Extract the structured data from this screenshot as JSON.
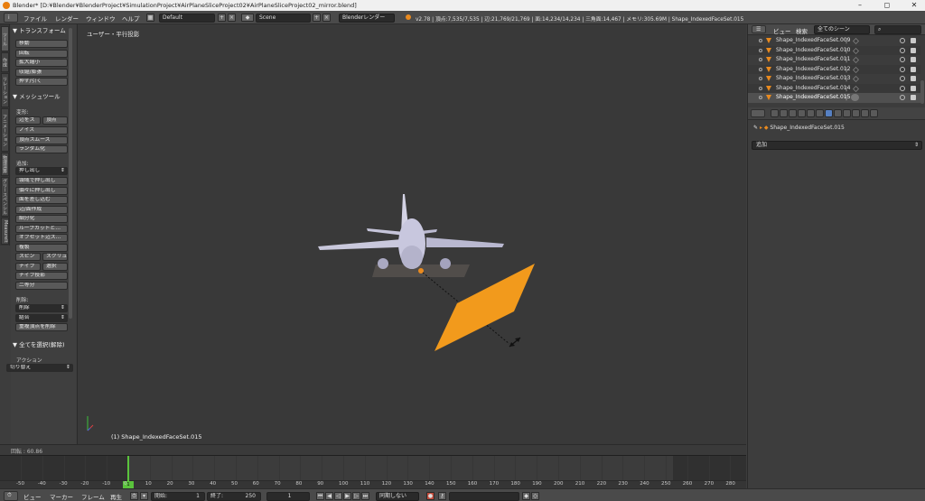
{
  "window": {
    "title": "Blender* [D:¥Blender¥BlenderProject¥SimulationProject¥AirPlaneSliceProject02¥AirPlaneSliceProject02_mirror.blend]",
    "minimize": "–",
    "maximize": "◻",
    "close": "✕"
  },
  "infobar": {
    "editor_icon": "i",
    "menus": [
      "ファイル",
      "レンダー",
      "ウィンドウ",
      "ヘルプ"
    ],
    "layout": "Default",
    "scene": "Scene",
    "render_engine": "Blenderレンダー",
    "stats": "v2.78 | 頂点:7,535/7,535 | 辺:21,769/21,769 | 面:14,234/14,234 | 三角面:14,467 | メモリ:305.69M | Shape_IndexedFaceSet.015"
  },
  "tool_shelf": {
    "tabs": [
      "ツール",
      "作成",
      "リレーション",
      "アニメーション",
      "物理演算",
      "グリースペンシル",
      "MeasureIt"
    ],
    "transform": {
      "header": "▼ トランスフォーム",
      "buttons": [
        "移動",
        "回転",
        "拡大縮小",
        "収縮/膨張",
        "押す/引く"
      ]
    },
    "mesh_tools": {
      "header": "▼ メッシュツール",
      "deform_label": "変形:",
      "deform_row1": [
        "辺をス",
        "頂点"
      ],
      "deform_buttons": [
        "ノイズ",
        "頂点スムーズ",
        "ランダム化"
      ],
      "add_label": "追加:",
      "extrude": "押し出し",
      "add_buttons": [
        "領域で押し出し",
        "個々に押し出し",
        "面を差し込む",
        "辺/面作成",
        "細分化",
        "ループカットと…",
        "オフセット辺ス…",
        "複製"
      ],
      "spin_row": [
        "スピン",
        "スクリュ"
      ],
      "knife_row": [
        "ナイフ",
        "選択"
      ],
      "more_buttons": [
        "ナイフ投影",
        "二等分"
      ],
      "remove_label": "削除:",
      "delete": "削除",
      "dissolve": "結合",
      "remove_doubles": "重複頂点を削除"
    },
    "select_all": {
      "header": "▼ 全てを選択(解除)",
      "action_label": "アクション",
      "action_value": "切り替え"
    }
  },
  "viewport": {
    "view_label": "ユーザー・平行投影",
    "object_label": "(1) Shape_IndexedFaceSet.015"
  },
  "operator_bar": {
    "label": "回転 : 60.86"
  },
  "timeline": {
    "ticks": [
      "-50",
      "-40",
      "-30",
      "-20",
      "-10",
      "0",
      "10",
      "20",
      "30",
      "40",
      "50",
      "60",
      "70",
      "80",
      "90",
      "100",
      "110",
      "120",
      "130",
      "140",
      "150",
      "160",
      "170",
      "180",
      "190",
      "200",
      "210",
      "220",
      "230",
      "240",
      "250",
      "260",
      "270",
      "280"
    ],
    "current_frame": "1",
    "menus": [
      "ビュー",
      "マーカー",
      "フレーム",
      "再生"
    ],
    "start_label": "開始:",
    "start_value": "1",
    "end_label": "終了:",
    "end_value": "250",
    "frame_value": "1",
    "sync": "同期しない"
  },
  "outliner": {
    "menus": [
      "ビュー",
      "検索"
    ],
    "scope": "全てのシーン",
    "rows": [
      "Shape_IndexedFaceSet.009",
      "Shape_IndexedFaceSet.010",
      "Shape_IndexedFaceSet.011",
      "Shape_IndexedFaceSet.012",
      "Shape_IndexedFaceSet.013",
      "Shape_IndexedFaceSet.014",
      "Shape_IndexedFaceSet.015"
    ]
  },
  "properties": {
    "path": "Shape_IndexedFaceSet.015",
    "add_modifier": "追加"
  },
  "colors": {
    "accent_orange": "#e98a1f",
    "playhead_green": "#5ac33c",
    "active_tab_blue": "#5680c2"
  }
}
